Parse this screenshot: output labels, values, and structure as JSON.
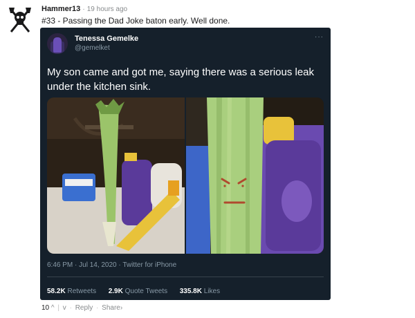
{
  "comment": {
    "username": "Hammer13",
    "separator": "·",
    "time_ago": "19 hours ago",
    "text": "#33 - Passing the Dad Joke baton early. Well done."
  },
  "tweet": {
    "display_name": "Tenessa Gemelke",
    "handle": "@gemelket",
    "more": "···",
    "text": "My son came and got me, saying there was a serious leak under the kitchen sink.",
    "timestamp": "6:46 PM · Jul 14, 2020 · Twitter for iPhone",
    "stats": {
      "retweets_count": "58.2K",
      "retweets_label": "Retweets",
      "quote_count": "2.9K",
      "quote_label": "Quote Tweets",
      "likes_count": "335.8K",
      "likes_label": "Likes"
    }
  },
  "actions": {
    "score": "10",
    "upvote": "^",
    "divider": "|",
    "downvote": "v",
    "dot": "·",
    "reply": "Reply",
    "share": "Share",
    "share_arrow": "›"
  },
  "colors": {
    "tweet_bg": "#15202b",
    "tweet_secondary": "#8899a6",
    "leek_green": "#9bc46a",
    "bottle_purple": "#5a3a9a",
    "cap_yellow": "#e8c23a"
  },
  "icons": {
    "avatar": "skull-crossed-axes-icon"
  }
}
